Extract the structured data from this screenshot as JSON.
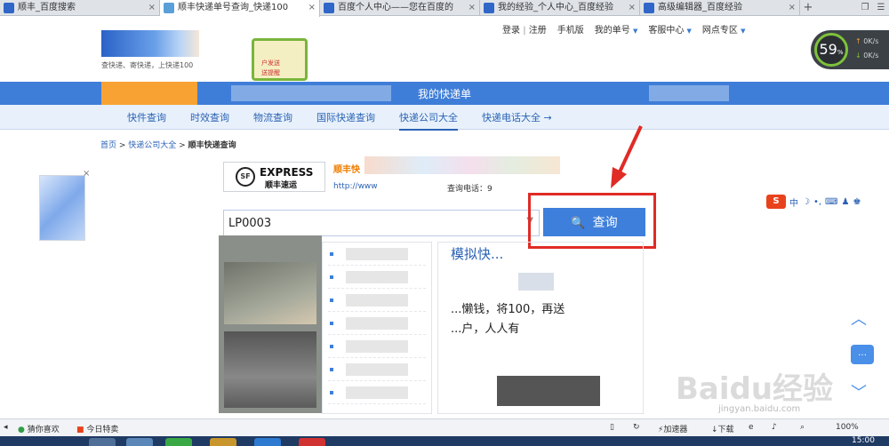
{
  "browser": {
    "tabs": [
      {
        "title": "顺丰_百度搜索",
        "active": false
      },
      {
        "title": "顺丰快递单号查询_快递100",
        "active": true
      },
      {
        "title": "百度个人中心——您在百度的",
        "active": false
      },
      {
        "title": "我的经验_个人中心_百度经验",
        "active": false
      },
      {
        "title": "高级编辑器_百度经验",
        "active": false
      }
    ]
  },
  "header": {
    "logo_tagline": "查快递、寄快递，上快递100",
    "promo_line1": "户发送",
    "promo_line2": "送提醒",
    "top_links": {
      "login": "登录",
      "register": "注册",
      "mobile": "手机版",
      "my_number": "我的单号",
      "service": "客服中心",
      "outlets": "网点专区"
    }
  },
  "speed_widget": {
    "percent": "59",
    "unit": "%",
    "up": "0K/s",
    "down": "0K/s"
  },
  "nav": {
    "banner_text": "我的快递单",
    "items": [
      "快件查询",
      "时效查询",
      "物流查询",
      "国际快递查询",
      "快递公司大全",
      "快递电话大全 →"
    ],
    "active_index": 4
  },
  "breadcrumb": {
    "home": "首页",
    "companies": "快递公司大全",
    "current": "顺丰快递查询"
  },
  "company": {
    "logo_en": "EXPRESS",
    "logo_cn": "顺丰速运",
    "logo_badge": "SF",
    "name": "顺丰快",
    "url": "http://www",
    "tel_label": "查询电话：9"
  },
  "search": {
    "value": "LP0003",
    "button": "查询",
    "icon": "search-icon"
  },
  "result": {
    "card_title": "模拟快...",
    "line1": "...懒钱，将100，再送",
    "line2": "...户，人人有"
  },
  "ime": {
    "brand": "S",
    "items": [
      "中",
      "☽",
      "•,",
      "⌨",
      "♟",
      "♚",
      "✦"
    ]
  },
  "watermark": {
    "text": "Baidu经验",
    "url": "jingyan.baidu.com"
  },
  "statusbar": {
    "guess": "猜你喜欢",
    "deals": "今日特卖",
    "accelerator": "加速器",
    "download": "下载",
    "zoom": "100%"
  },
  "taskbar": {
    "clock": "15:00"
  },
  "colors": {
    "accent": "#3d7fdb",
    "orange": "#f7a233",
    "annotation_red": "#e02b26"
  }
}
